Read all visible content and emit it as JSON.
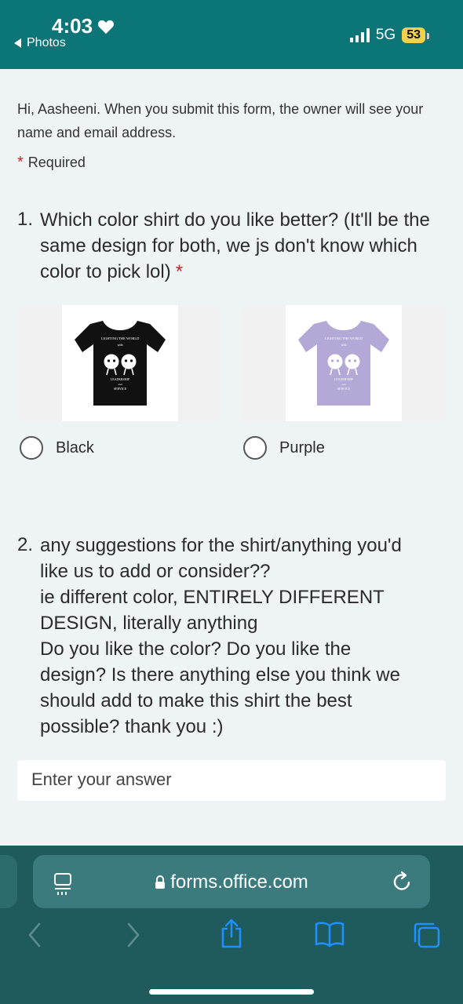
{
  "status": {
    "time": "4:03",
    "back_app": "Photos",
    "network": "5G",
    "battery": "53"
  },
  "form": {
    "intro": "Hi, Aasheeni. When you submit this form, the owner will see your name and email address.",
    "required_star": "*",
    "required_label": "Required",
    "q1": {
      "number": "1.",
      "text": "Which color shirt do you like better? (It'll be the same design for both, we js don't know which color to pick lol)",
      "star": "*",
      "options": [
        {
          "label": "Black",
          "shirt_color": "#111111",
          "print_color": "#ffffff"
        },
        {
          "label": "Purple",
          "shirt_color": "#b4a8d6",
          "print_color": "#ffffff"
        }
      ],
      "shirt_print": {
        "top": "LIGHTING THE WORLD",
        "top2": "with",
        "bottom": "LEADERSHIP",
        "bottom2": "and",
        "bottom3": "SERVICE"
      }
    },
    "q2": {
      "number": "2.",
      "lines": [
        "any suggestions for the shirt/anything you'd",
        "like us to add or consider??",
        "ie different color, ENTIRELY DIFFERENT",
        "DESIGN, literally anything",
        "Do you like the color? Do you like the",
        "design? Is there anything else you think we",
        "should add to make this shirt the best",
        "possible? thank you :)"
      ]
    },
    "answer_placeholder": "Enter your answer"
  },
  "browser": {
    "url": "forms.office.com"
  },
  "colors": {
    "header": "#0b7577",
    "toolbar": "#1f5a5c",
    "accent_icon": "#1e90ff",
    "required": "#c4262e"
  },
  "icons": [
    "heart-icon",
    "back-arrow-icon",
    "signal-icon",
    "lock-icon",
    "tabs-icon",
    "reload-icon",
    "back-icon",
    "forward-icon",
    "share-icon",
    "bookmarks-icon",
    "tab-switcher-icon"
  ]
}
